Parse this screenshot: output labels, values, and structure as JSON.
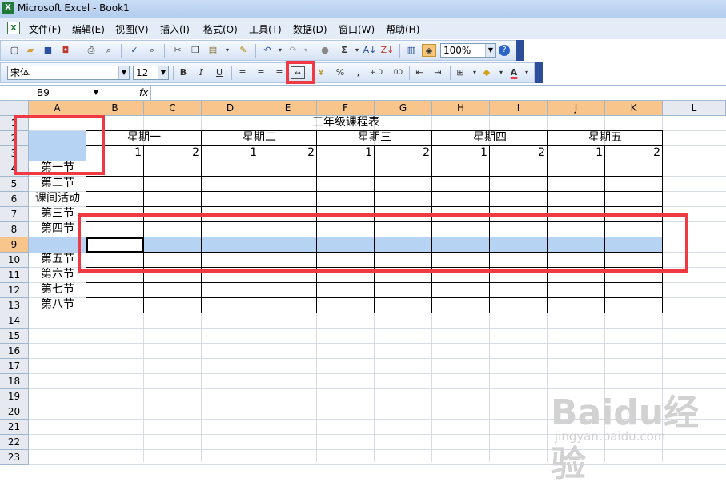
{
  "window": {
    "app_icon": "excel-icon",
    "title": "Microsoft Excel - Book1"
  },
  "menu": [
    "文件(F)",
    "编辑(E)",
    "视图(V)",
    "插入(I)",
    "格式(O)",
    "工具(T)",
    "数据(D)",
    "窗口(W)",
    "帮助(H)"
  ],
  "toolbar": {
    "zoom": "100%"
  },
  "format_toolbar": {
    "font": "宋体",
    "font_size": "12",
    "bold": "B",
    "italic": "I",
    "underline": "U",
    "percent": "%",
    "comma": ",",
    "inc_decimal": "+.0",
    "dec_decimal": ".00"
  },
  "formula_bar": {
    "name_box": "B9",
    "fx": "fx",
    "formula": ""
  },
  "sheet": {
    "columns": [
      "A",
      "B",
      "C",
      "D",
      "E",
      "F",
      "G",
      "H",
      "I",
      "J",
      "K",
      "L"
    ],
    "rows": [
      "1",
      "2",
      "3",
      "4",
      "5",
      "6",
      "7",
      "8",
      "9",
      "10",
      "11",
      "12",
      "13",
      "14",
      "15",
      "16",
      "17",
      "18",
      "19",
      "20",
      "21",
      "22",
      "23"
    ],
    "selected_row": "9",
    "active_cell": "B9",
    "title": "三年级课程表",
    "days": [
      "星期一",
      "星期二",
      "星期三",
      "星期四",
      "星期五"
    ],
    "period_numbers": [
      "1",
      "2",
      "1",
      "2",
      "1",
      "2",
      "1",
      "2",
      "1",
      "2"
    ],
    "row_labels": [
      "第一节",
      "第二节",
      "课间活动",
      "第三节",
      "第四节",
      "",
      "第五节",
      "第六节",
      "第七节",
      "第八节"
    ]
  },
  "watermark": {
    "brand": "Baidu经验",
    "url": "jingyan.baidu.com"
  },
  "colors": {
    "highlight": "#ef3a43",
    "selection": "#b7d3f3",
    "header_selected": "#f8c58c"
  }
}
